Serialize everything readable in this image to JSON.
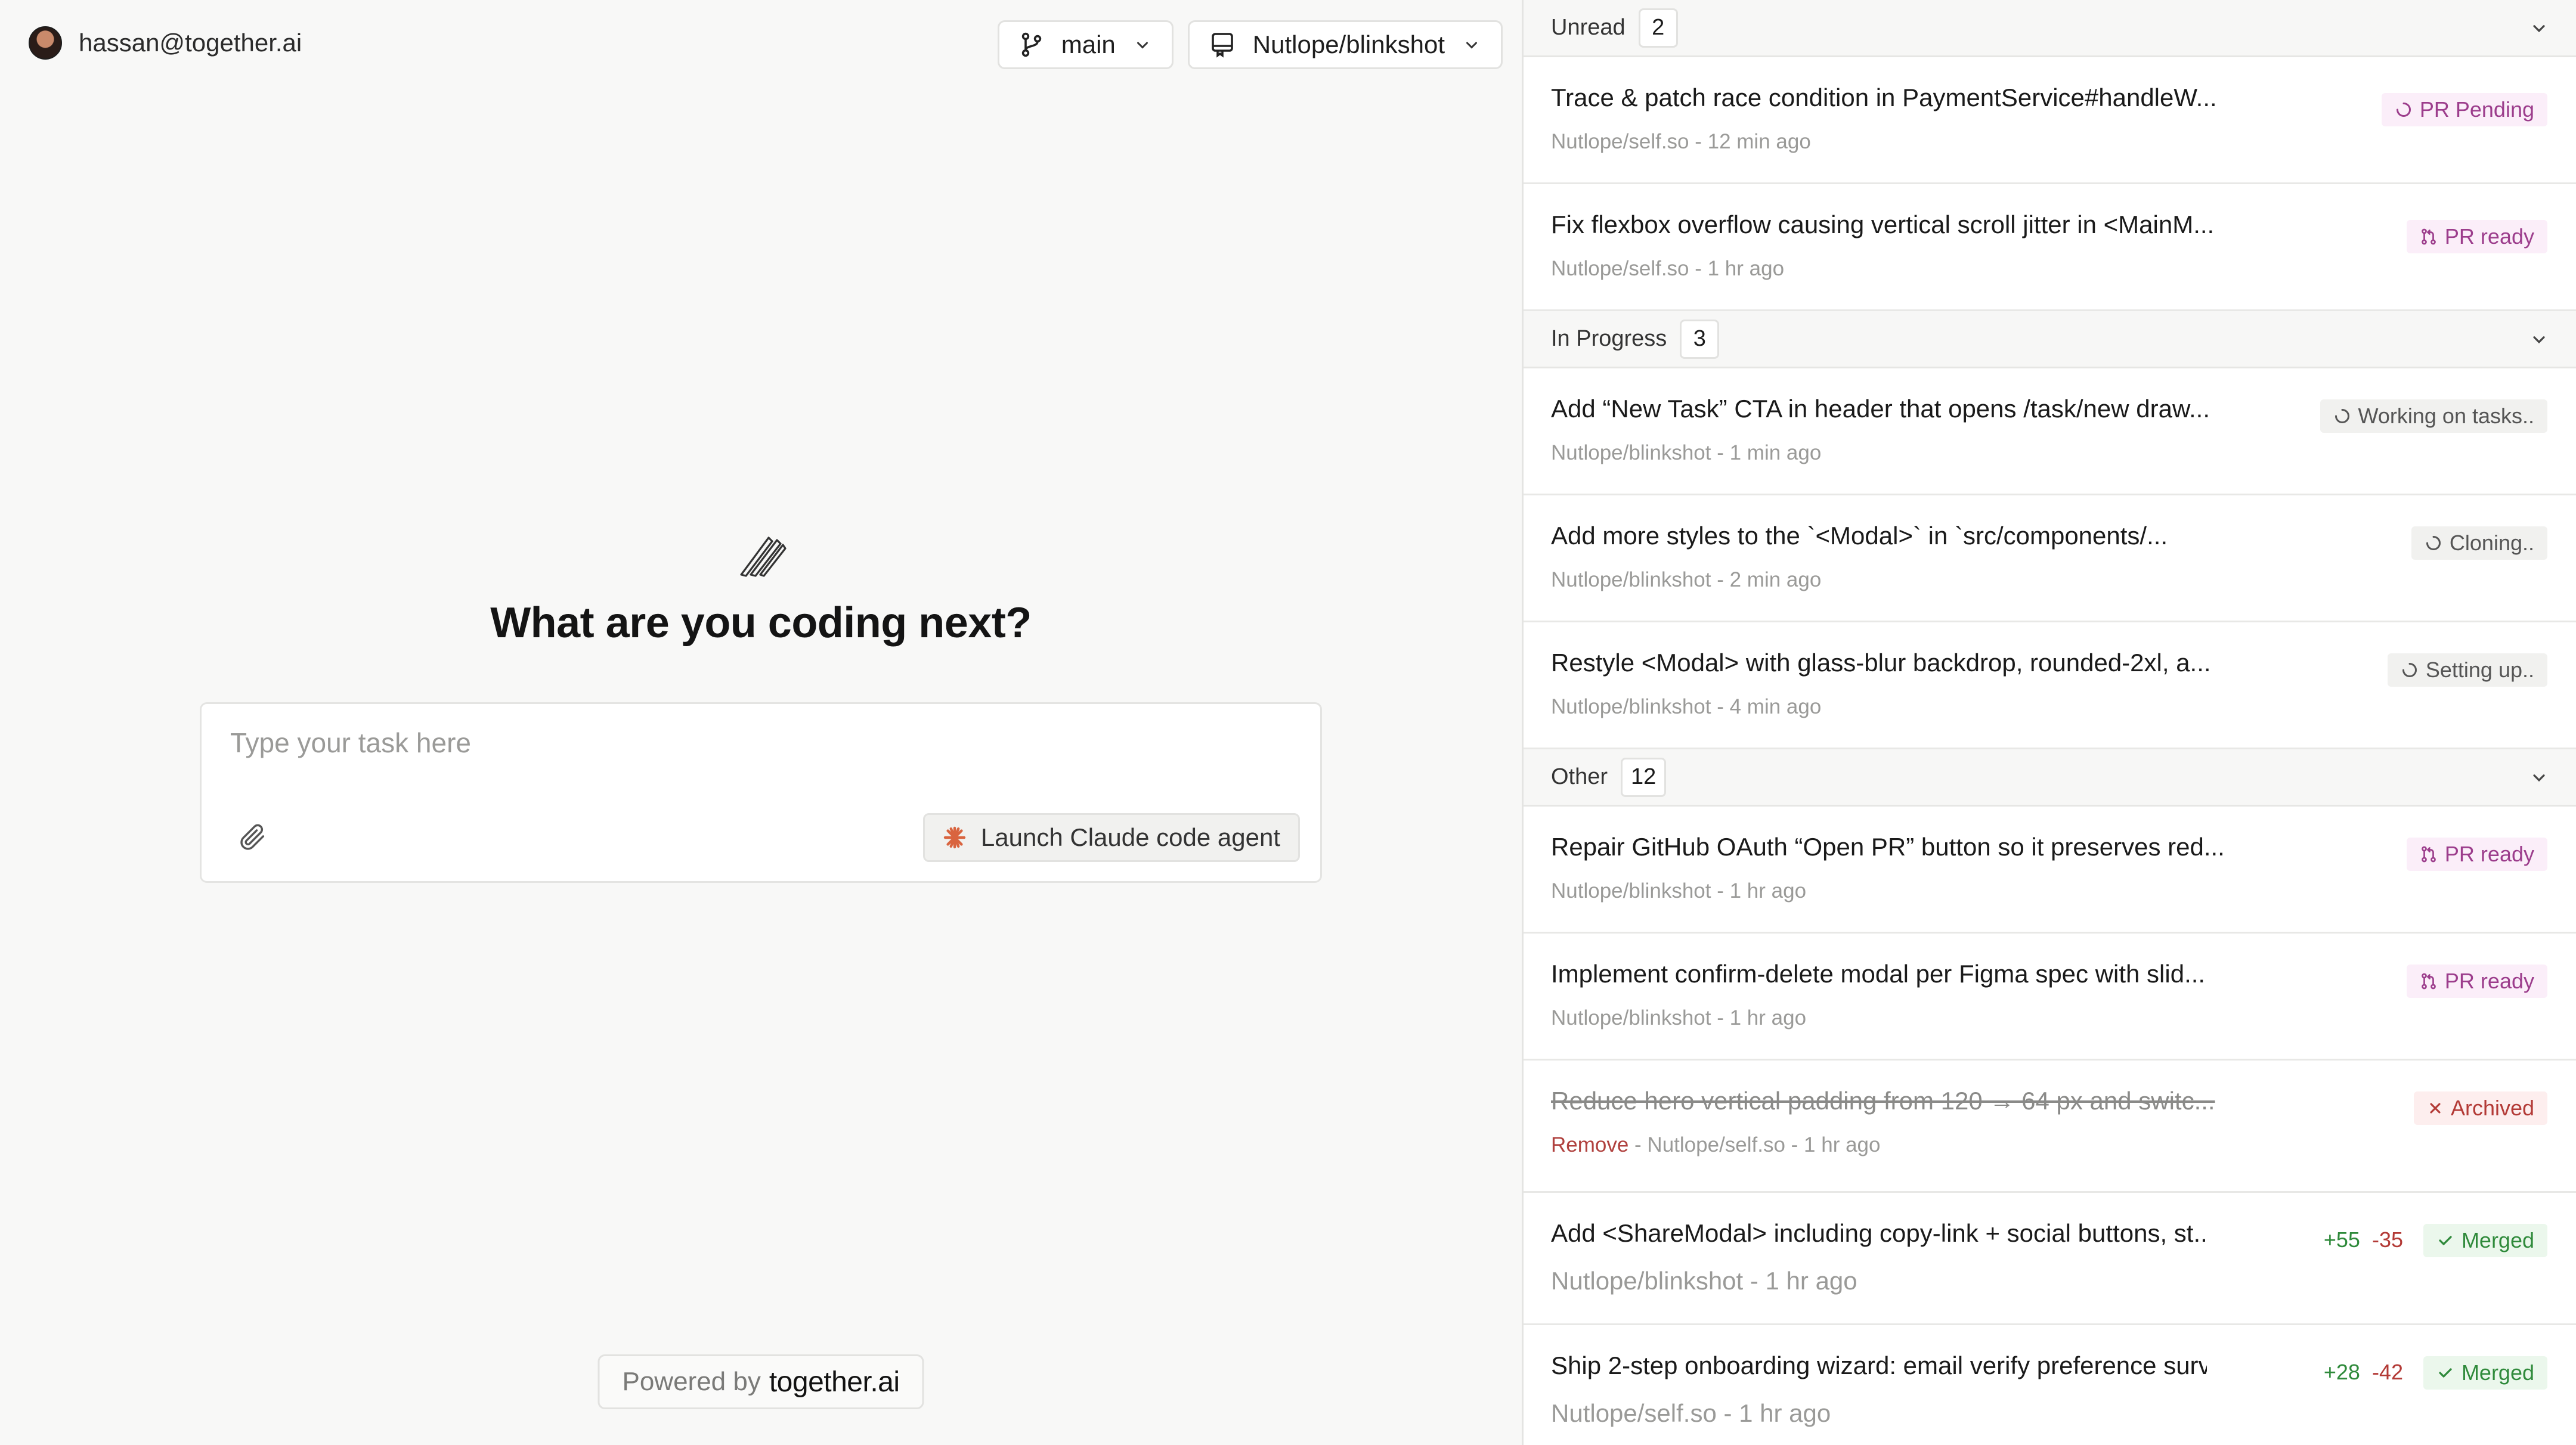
{
  "user": {
    "email": "hassan@together.ai"
  },
  "controls": {
    "branch": "main",
    "repo": "Nutlope/blinkshot"
  },
  "main": {
    "headline": "What are you coding next?",
    "placeholder": "Type your task here",
    "launch_label": "Launch Claude code agent",
    "powered_prefix": "Powered by",
    "powered_brand": "together.ai"
  },
  "colors": {
    "accent_pr": "#9c3d8c",
    "merged": "#2f8a3b",
    "archived": "#b33a36",
    "launch_star": "#d9643f"
  },
  "sections": {
    "unread": {
      "label": "Unread",
      "count": "2",
      "tasks": [
        {
          "title": "Trace & patch race condition in PaymentService#handleW...",
          "meta": "Nutlope/self.so - 12 min ago",
          "badge": "PR Pending",
          "badge_icon": "spinner-icon"
        },
        {
          "title": "Fix flexbox overflow causing vertical scroll jitter in <MainM...",
          "meta": "Nutlope/self.so - 1 hr ago",
          "badge": "PR ready",
          "badge_icon": "pull-request-icon"
        }
      ]
    },
    "in_progress": {
      "label": "In Progress",
      "count": "3",
      "tasks": [
        {
          "title": "Add “New Task” CTA in header that opens /task/new draw...",
          "meta": "Nutlope/blinkshot - 1 min ago",
          "badge": "Working on tasks..",
          "badge_icon": "spinner-icon"
        },
        {
          "title": "Add more styles to the `<Modal>` in `src/components/...",
          "meta": "Nutlope/blinkshot - 2 min ago",
          "badge": "Cloning..",
          "badge_icon": "spinner-icon"
        },
        {
          "title": "Restyle <Modal> with glass-blur backdrop, rounded-2xl, a...",
          "meta": "Nutlope/blinkshot - 4 min ago",
          "badge": "Setting up..",
          "badge_icon": "spinner-icon"
        }
      ]
    },
    "other": {
      "label": "Other",
      "count": "12",
      "tasks": [
        {
          "title": "Repair GitHub OAuth “Open PR” button so it preserves red...",
          "meta": "Nutlope/blinkshot - 1 hr ago",
          "badge": "PR ready",
          "badge_icon": "pull-request-icon"
        },
        {
          "title": "Implement confirm-delete modal per Figma spec with slid...",
          "meta": "Nutlope/blinkshot - 1 hr ago",
          "badge": "PR ready",
          "badge_icon": "pull-request-icon"
        },
        {
          "title": "Reduce hero vertical padding from 120 → 64 px and switc...",
          "remove_label": "Remove",
          "meta": " - Nutlope/self.so - 1 hr ago",
          "badge": "Archived",
          "badge_icon": "x-icon"
        },
        {
          "title": "Add <ShareModal> including copy-link + social buttons, st...",
          "meta": "Nutlope/blinkshot - 1 hr ago",
          "additions": "+55",
          "deletions": "-35",
          "badge": "Merged",
          "badge_icon": "check-icon"
        },
        {
          "title": "Ship 2-step onboarding wizard: email verify preference surv...",
          "meta": "Nutlope/self.so - 1 hr ago",
          "additions": "+28",
          "deletions": "-42",
          "badge": "Merged",
          "badge_icon": "check-icon"
        }
      ]
    }
  }
}
